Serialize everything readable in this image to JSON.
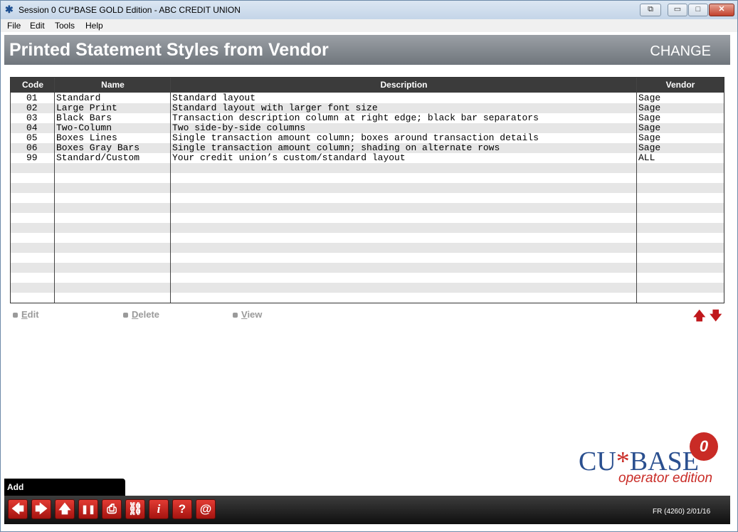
{
  "window": {
    "title": "Session 0 CU*BASE GOLD Edition - ABC CREDIT UNION",
    "icon": "asterisk-app-icon",
    "controls": {
      "restore": "⧉",
      "minimize": "▭",
      "maximize": "□",
      "close": "✕"
    }
  },
  "menu": [
    "File",
    "Edit",
    "Tools",
    "Help"
  ],
  "header": {
    "title": "Printed Statement Styles from Vendor",
    "mode": "CHANGE"
  },
  "table": {
    "columns": [
      "Code",
      "Name",
      "Description",
      "Vendor"
    ],
    "rows": [
      {
        "code": "01",
        "name": "Standard",
        "description": "Standard layout",
        "vendor": "Sage"
      },
      {
        "code": "02",
        "name": "Large Print",
        "description": "Standard layout with larger font size",
        "vendor": "Sage"
      },
      {
        "code": "03",
        "name": "Black Bars",
        "description": "Transaction description column at right edge; black bar separators",
        "vendor": "Sage"
      },
      {
        "code": "04",
        "name": "Two-Column",
        "description": "Two side-by-side columns",
        "vendor": "Sage"
      },
      {
        "code": "05",
        "name": "Boxes Lines",
        "description": "Single transaction amount column; boxes around transaction details",
        "vendor": "Sage"
      },
      {
        "code": "06",
        "name": "Boxes Gray Bars",
        "description": "Single transaction amount column; shading on alternate rows",
        "vendor": "Sage"
      },
      {
        "code": "99",
        "name": "Standard/Custom",
        "description": "Your credit union’s custom/standard layout",
        "vendor": "ALL"
      }
    ]
  },
  "actions": [
    {
      "first": "E",
      "rest": "dit"
    },
    {
      "first": "D",
      "rest": "elete"
    },
    {
      "first": "V",
      "rest": "iew"
    }
  ],
  "scroll": {
    "up": "🡅",
    "down": "🡇"
  },
  "logo": {
    "cu": "CU",
    "star": "*",
    "base": "BASE",
    "edition": "operator edition",
    "badge": "0"
  },
  "add_tab": "Add",
  "toolbar": [
    "🡄",
    "🡆",
    "🡅",
    "❚❚",
    "⎙",
    "⛓",
    "i",
    "?",
    "@"
  ],
  "status": "FR (4260) 2/01/16",
  "colors": {
    "accent": "#c0181c",
    "header": "#6f757c",
    "stripe": "#e6e6e6"
  }
}
